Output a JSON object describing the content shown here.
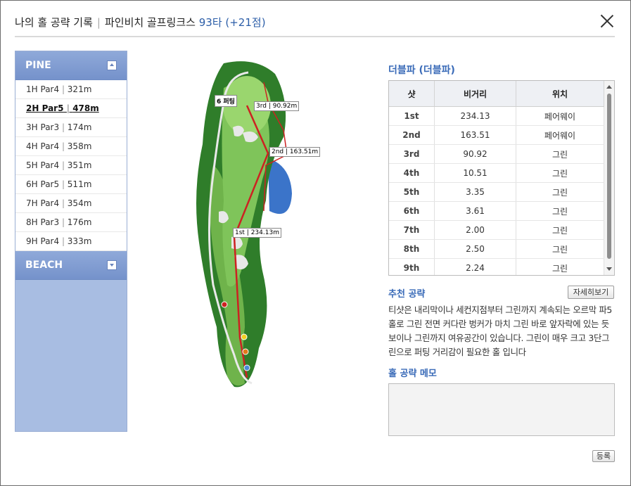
{
  "header": {
    "title": "나의 홀 공략 기록",
    "course": "파인비치 골프링크스",
    "score": "93타 (+21점)"
  },
  "courses": [
    {
      "name": "PINE",
      "holes": [
        {
          "num": "1H",
          "par": "Par4",
          "dist": "321m"
        },
        {
          "num": "2H",
          "par": "Par5",
          "dist": "478m"
        },
        {
          "num": "3H",
          "par": "Par3",
          "dist": "174m"
        },
        {
          "num": "4H",
          "par": "Par4",
          "dist": "358m"
        },
        {
          "num": "5H",
          "par": "Par4",
          "dist": "351m"
        },
        {
          "num": "6H",
          "par": "Par5",
          "dist": "511m"
        },
        {
          "num": "7H",
          "par": "Par4",
          "dist": "354m"
        },
        {
          "num": "8H",
          "par": "Par3",
          "dist": "176m"
        },
        {
          "num": "9H",
          "par": "Par4",
          "dist": "333m"
        }
      ]
    },
    {
      "name": "BEACH"
    }
  ],
  "map": {
    "putt_label": "6 퍼팅",
    "shot_labels": [
      "1st | 234.13m",
      "2nd | 163.51m",
      "3rd | 90.92m"
    ]
  },
  "result": {
    "title": "더블파 (더블파)",
    "columns": [
      "샷",
      "비거리",
      "위치"
    ],
    "rows": [
      {
        "shot": "1st",
        "dist": "234.13",
        "pos": "페어웨이"
      },
      {
        "shot": "2nd",
        "dist": "163.51",
        "pos": "페어웨이"
      },
      {
        "shot": "3rd",
        "dist": "90.92",
        "pos": "그린"
      },
      {
        "shot": "4th",
        "dist": "10.51",
        "pos": "그린"
      },
      {
        "shot": "5th",
        "dist": "3.35",
        "pos": "그린"
      },
      {
        "shot": "6th",
        "dist": "3.61",
        "pos": "그린"
      },
      {
        "shot": "7th",
        "dist": "2.00",
        "pos": "그린"
      },
      {
        "shot": "8th",
        "dist": "2.50",
        "pos": "그린"
      },
      {
        "shot": "9th",
        "dist": "2.24",
        "pos": "그린"
      }
    ]
  },
  "strategy": {
    "title": "추천 공략",
    "detail_button": "자세히보기",
    "text": "티샷은 내리막이나 세컨지점부터 그린까지 계속되는 오르막 파5홀로 그린 전면 커다란 벙커가 마치 그린 바로 앞자락에 있는 듯 보이나 그린까지 여유공간이 있습니다. 그린이 매우 크고 3단그린으로 퍼팅 거리감이 필요한 홀 입니다"
  },
  "memo": {
    "title": "홀 공략 메모",
    "value": "",
    "save_button": "등록"
  },
  "colors": {
    "accent": "#3a6bb8",
    "course_header": "#7b96cd",
    "shot_line": "#cc2222",
    "fairway": "#7fc45a",
    "rough": "#2f7d2a"
  }
}
